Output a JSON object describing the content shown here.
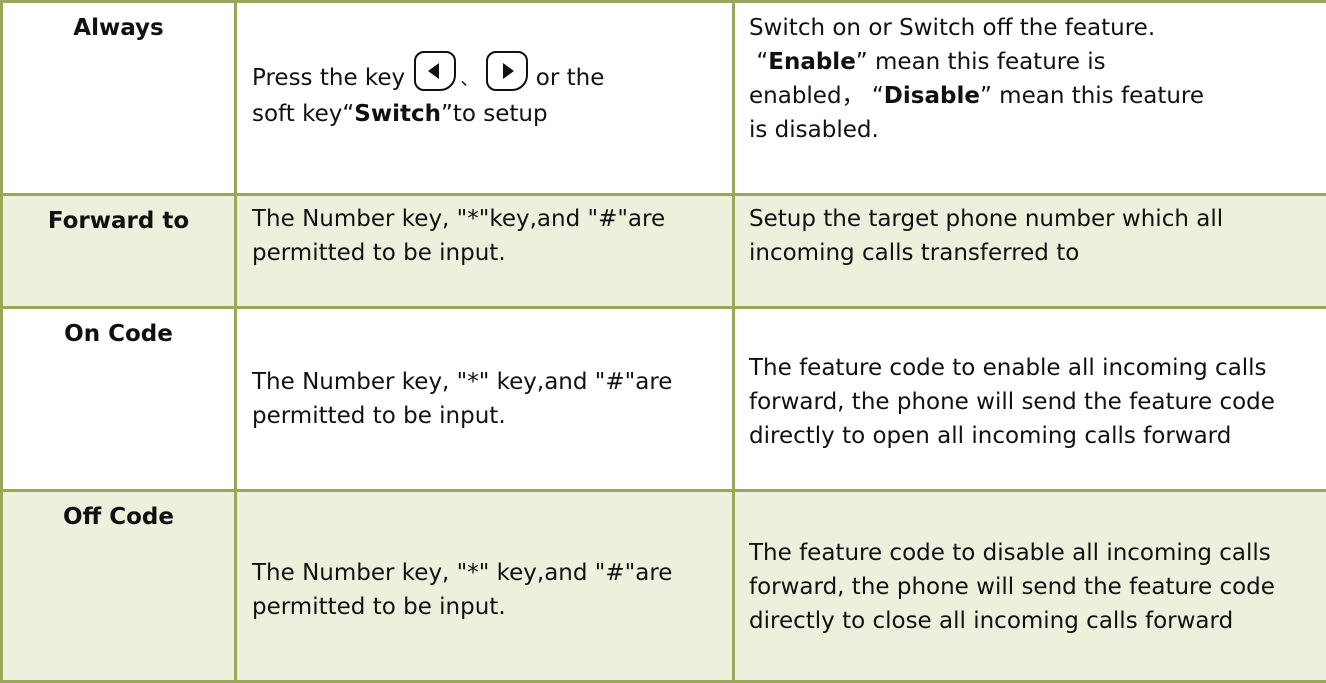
{
  "rows": [
    {
      "label": "Always",
      "input": {
        "prefix": "Press the key ",
        "separator": "、",
        "after_keys": " or the",
        "line2_pre": "soft key“",
        "softkey": "Switch",
        "line2_post": "”to setup",
        "keys": [
          "left-arrow-key-icon",
          "right-arrow-key-icon"
        ]
      },
      "description": {
        "line1": "Switch on or Switch off the feature.",
        "q_open": "“",
        "enable": "Enable",
        "enable_post": "” mean this feature is",
        "enabled_pre": "enabled， “",
        "disable": "Disable",
        "disable_post": "” mean this feature",
        "last": "is disabled."
      }
    },
    {
      "label": "Forward to",
      "input": "The Number key, \"*\"key,and \"#\"are permitted to be input.",
      "description": "Setup the target phone number which all incoming calls transferred to"
    },
    {
      "label": "On Code",
      "input": "The Number key, \"*\" key,and \"#\"are permitted to be input.",
      "description": "The feature code to enable all incoming calls forward, the phone will send the feature code directly to open all incoming calls forward"
    },
    {
      "label": "Off Code",
      "input": "The Number key, \"*\" key,and \"#\"are permitted to be input.",
      "description": "The feature code to disable all incoming calls forward, the phone will send the feature code directly to close all incoming calls forward"
    }
  ],
  "colors": {
    "border": "#9aa65a",
    "alt_row": "#ebf1dd"
  }
}
